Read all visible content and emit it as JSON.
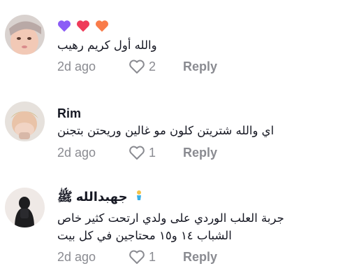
{
  "comments": [
    {
      "username": "",
      "reactions": [
        "purple-heart",
        "red-heart",
        "orange-heart"
      ],
      "text": "والله أول كريم رهيب",
      "time": "2d ago",
      "likes": "2",
      "reply_label": "Reply"
    },
    {
      "username": "Rim",
      "text": "اي والله شتريتن كلون مو غالين وريحتن بتجنن",
      "time": "2d ago",
      "likes": "1",
      "reply_label": "Reply"
    },
    {
      "username": "جهبدالله ﷺ",
      "text_line1": "جربة العلب الوردي على ولدي ارتحت كثير خاص",
      "text_line2": "الشباب ١٤ و١٥ محتاجين في كل بيت",
      "time": "2d ago",
      "likes": "1",
      "reply_label": "Reply"
    }
  ],
  "colors": {
    "text": "#161823",
    "secondary": "#8a8b91",
    "heart_purple": "#8b5cf6",
    "heart_red": "#ef3b5a",
    "heart_orange": "#f97c4a"
  },
  "icons": {
    "like": "heart-outline-icon"
  }
}
